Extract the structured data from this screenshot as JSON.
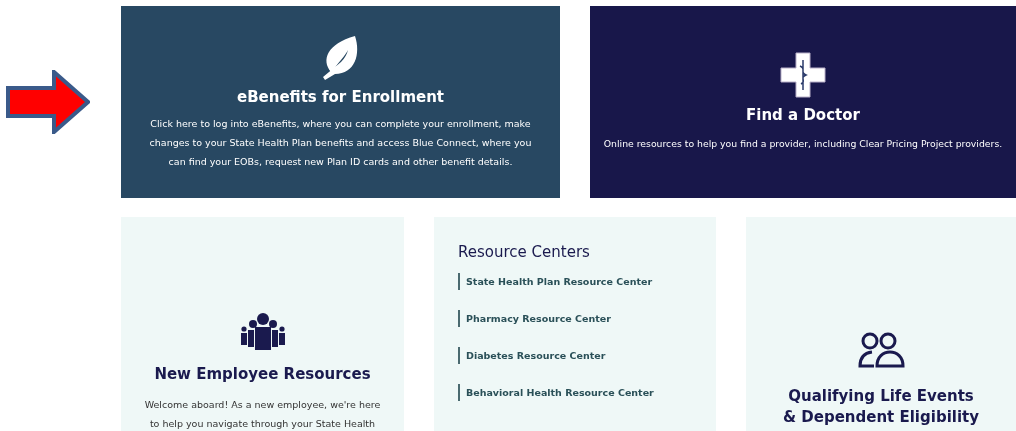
{
  "top_cards": [
    {
      "kind": "leaf",
      "title": "eBenefits for Enrollment",
      "text": "Click here to log into eBenefits, where you can complete your enrollment, make changes to your State Health Plan benefits and access Blue Connect, where you can find your EOBs, request new Plan ID cards and other benefit details.",
      "color": "#284862"
    },
    {
      "kind": "cross",
      "title": "Find a Doctor",
      "text": "Online resources to help you find a provider, including Clear Pricing Project providers.",
      "color": "#18174a"
    }
  ],
  "new_employee": {
    "title": "New Employee Resources",
    "text": "Welcome aboard! As a new employee, we're here to help you navigate through your State Health"
  },
  "resource_centers": {
    "title": "Resource Centers",
    "links": [
      "State Health Plan Resource Center",
      "Pharmacy Resource Center",
      "Diabetes Resource Center",
      "Behavioral Health Resource Center"
    ]
  },
  "life_events": {
    "title": "Qualifying Life Events & Dependent Eligibility"
  }
}
